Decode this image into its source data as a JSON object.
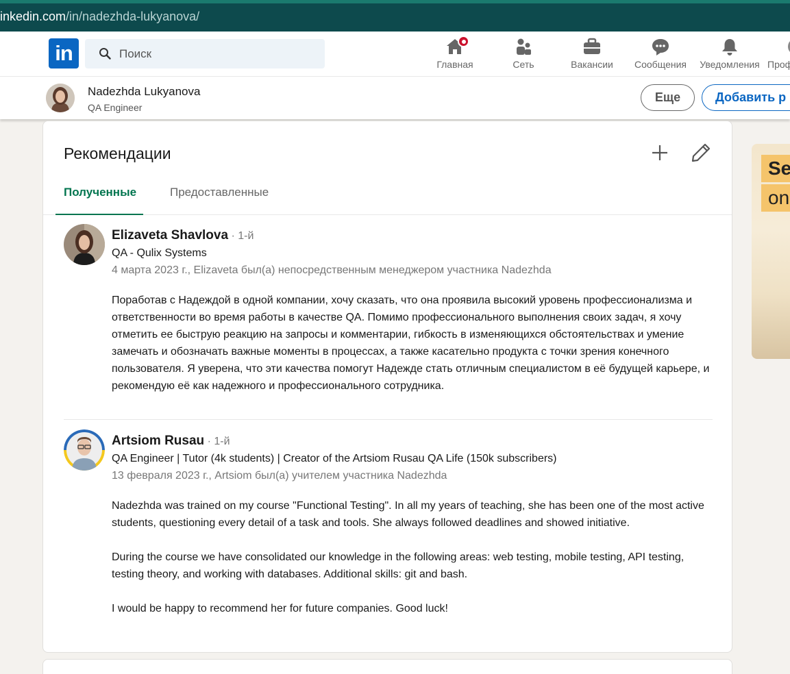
{
  "browser": {
    "url_domain": "inkedin.com",
    "url_path": "/in/nadezhda-lukyanova/"
  },
  "nav": {
    "logo": "in",
    "search_placeholder": "Поиск",
    "items": [
      {
        "label": "Главная",
        "icon": "home-icon",
        "has_badge": true
      },
      {
        "label": "Сеть",
        "icon": "network-icon"
      },
      {
        "label": "Вакансии",
        "icon": "briefcase-icon"
      },
      {
        "label": "Сообщения",
        "icon": "messaging-icon"
      },
      {
        "label": "Уведомления",
        "icon": "bell-icon"
      },
      {
        "label": "Проф",
        "icon": "profile-icon"
      }
    ]
  },
  "profile_header": {
    "name": "Nadezhda Lukyanova",
    "title": "QA Engineer",
    "more_label": "Еще",
    "add_label": "Добавить р"
  },
  "recommendations": {
    "title": "Рекомендации",
    "tabs": [
      {
        "label": "Полученные",
        "active": true
      },
      {
        "label": "Предоставленные",
        "active": false
      }
    ],
    "items": [
      {
        "name": "Elizaveta Shavlova",
        "degree": " · 1-й",
        "headline": "QA - Qulix Systems",
        "meta": "4 марта 2023 г., Elizaveta был(а) непосредственным менеджером участника Nadezhda",
        "text": [
          "Поработав с Надеждой в одной компании, хочу сказать, что она проявила высокий уровень профессионализма и ответственности во время работы в качестве QA. Помимо профессионального выполнения своих задач, я хочу отметить ее быструю реакцию на запросы и комментарии, гибкость в изменяющихся обстоятельствах и умение замечать и обозначать важные моменты в процессах, а также касательно продукта с точки зрения конечного пользователя. Я уверена, что эти качества помогут Надежде стать отличным специалистом в её будущей карьере, и рекомендую её как надежного и профессионального сотрудника."
        ]
      },
      {
        "name": "Artsiom Rusau",
        "degree": " · 1-й",
        "headline": "QA Engineer | Tutor (4k students) | Creator of the Artsiom Rusau QA Life (150k subscribers)",
        "meta": "13 февраля 2023 г., Artsiom был(а) учителем участника Nadezhda",
        "text": [
          "Nadezhda was trained on my course \"Functional Testing\". In all my years of teaching, she has been one of the most active students, questioning every detail of a task and tools. She always followed deadlines and showed initiative.",
          "During the course we have consolidated our knowledge in the following areas: web testing, mobile testing, API testing, testing theory, and working with databases. Additional skills: git and bash.",
          "I would be happy to recommend her for future companies. Good luck!"
        ]
      }
    ]
  },
  "side_ad": {
    "line1": "Se",
    "line2": "on"
  },
  "colors": {
    "brand": "#0a66c2",
    "active_tab": "#01754f",
    "badge": "#cb112d",
    "url_bar": "#0d4a4d"
  }
}
